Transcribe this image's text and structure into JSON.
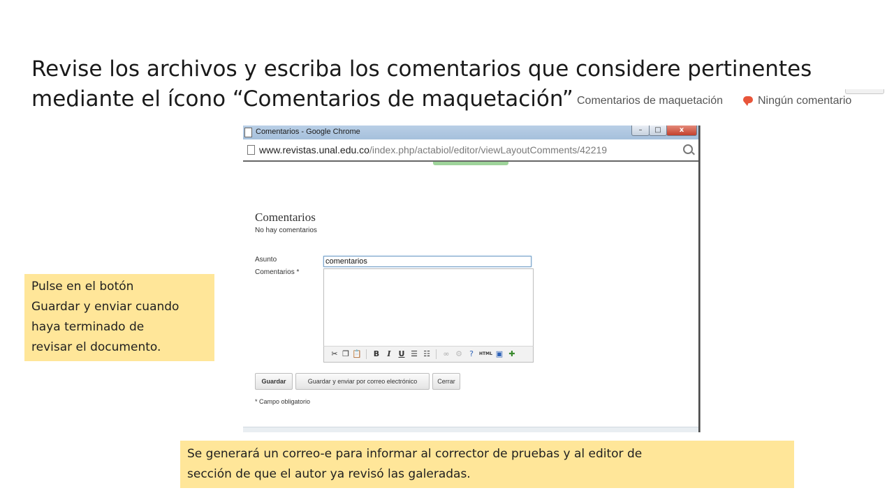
{
  "slide": {
    "title_line1": "Revise los archivos y escriba los comentarios que considere pertinentes",
    "title_line2": "mediante el ícono “Comentarios de maquetación”"
  },
  "reference": {
    "label": "Comentarios de maquetación",
    "icon": "speech-bubble-icon",
    "status": "Ningún comentario"
  },
  "window": {
    "title": "Comentarios - Google Chrome",
    "controls": {
      "minimize": "–",
      "maximize": "□",
      "close": "x"
    },
    "url_host": "www.revistas.unal.edu.co",
    "url_path": "/index.php/actabiol/editor/viewLayoutComments/42219",
    "heading": "Comentarios",
    "no_comments": "No hay comentarios",
    "form": {
      "subject_label": "Asunto",
      "subject_value": "comentarios",
      "comments_label": "Comentarios *",
      "comments_value": ""
    },
    "toolbar_icons": [
      "cut-icon",
      "copy-icon",
      "paste-icon",
      "bold-icon",
      "italic-icon",
      "underline-icon",
      "bulleted-list-icon",
      "numbered-list-icon",
      "link-icon",
      "unlink-icon",
      "help-icon",
      "html-icon",
      "fullscreen-icon",
      "image-icon"
    ],
    "toolbar_text": {
      "bold": "B",
      "italic": "I",
      "underline": "U",
      "html": "HTML"
    },
    "buttons": {
      "save": "Guardar",
      "save_send": "Guardar y enviar por correo electrónico",
      "close": "Cerrar"
    },
    "required_note": "* Campo obligatorio"
  },
  "notes": {
    "left_line1": "Pulse en el botón",
    "left_line2": "Guardar y enviar cuando",
    "left_line3": "haya terminado de",
    "left_line4": "revisar el documento.",
    "bottom_line1": "Se generará un correo-e para informar al corrector de pruebas y al editor de",
    "bottom_line2": "sección de que el autor ya revisó las galeradas."
  },
  "colors": {
    "note_bg": "#ffe699",
    "accent_bubble": "#e8553a"
  }
}
